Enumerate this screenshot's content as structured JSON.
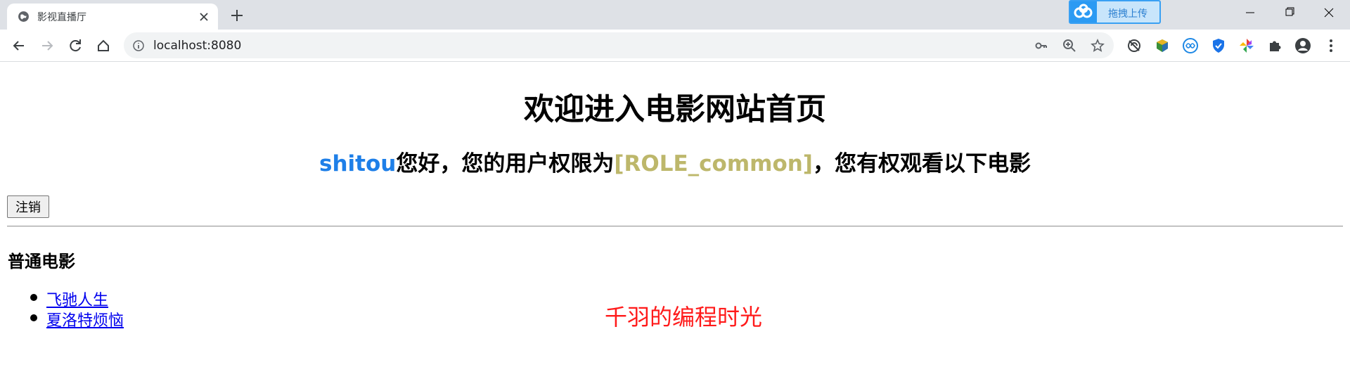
{
  "browser": {
    "tab_title": "影视直播厅",
    "url": "localhost:8080",
    "extension_upload_label": "拖拽上传"
  },
  "page": {
    "title": "欢迎进入电影网站首页",
    "greeting_user": "shitou",
    "greeting_middle": "您好，您的用户权限为",
    "greeting_role": "[ROLE_common]",
    "greeting_end": "，您有权观看以下电影",
    "logout_label": "注销",
    "section_title": "普通电影",
    "movies": [
      "飞驰人生",
      "夏洛特烦恼"
    ],
    "watermark": "千羽的编程时光"
  },
  "colors": {
    "user": "#1e7fe8",
    "role": "#bdb76b",
    "watermark": "#ff1a1a",
    "link": "#0000ee"
  }
}
